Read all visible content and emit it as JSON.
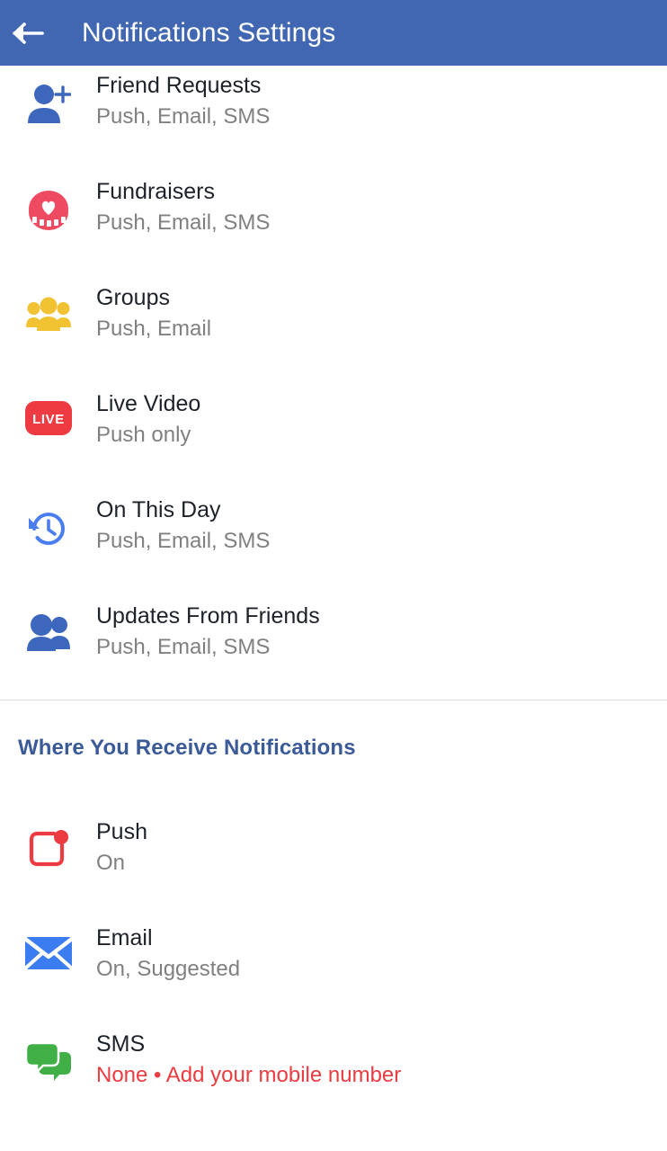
{
  "header": {
    "title": "Notifications Settings",
    "back_icon": "arrow-left-icon",
    "background_color": "#4267b2",
    "text_color": "#ffffff"
  },
  "notification_types": [
    {
      "label": "",
      "sublabel": "Push, Email, SMS",
      "icon": "crown-icon",
      "icon_color": "#ed4f67",
      "clipped": true
    },
    {
      "label": "Friend Requests",
      "sublabel": "Push, Email, SMS",
      "icon": "person-add-icon",
      "icon_color": "#3d66bd"
    },
    {
      "label": "Fundraisers",
      "sublabel": "Push, Email, SMS",
      "icon": "coin-heart-icon",
      "icon_color": "#ee4a62"
    },
    {
      "label": "Groups",
      "sublabel": "Push, Email",
      "icon": "people-group-icon",
      "icon_color": "#f1c232"
    },
    {
      "label": "Live Video",
      "sublabel": "Push only",
      "icon": "live-badge-icon",
      "icon_color": "#ed3b41",
      "icon_text": "LIVE"
    },
    {
      "label": "On This Day",
      "sublabel": "Push, Email, SMS",
      "icon": "history-clock-icon",
      "icon_color": "#4a7ded"
    },
    {
      "label": "Updates From Friends",
      "sublabel": "Push, Email, SMS",
      "icon": "two-people-icon",
      "icon_color": "#3d66bd"
    }
  ],
  "section": {
    "title": "Where You Receive Notifications",
    "title_color": "#3b5a98"
  },
  "delivery_channels": [
    {
      "label": "Push",
      "sublabel": "On",
      "sublabel_alert": false,
      "icon": "push-notification-icon",
      "icon_color": "#ec3b41"
    },
    {
      "label": "Email",
      "sublabel": "On, Suggested",
      "sublabel_alert": false,
      "icon": "envelope-icon",
      "icon_color": "#3b7cf0"
    },
    {
      "label": "SMS",
      "sublabel": "None • Add your mobile number",
      "sublabel_alert": true,
      "icon": "chat-bubbles-icon",
      "icon_color": "#3faf46"
    }
  ]
}
